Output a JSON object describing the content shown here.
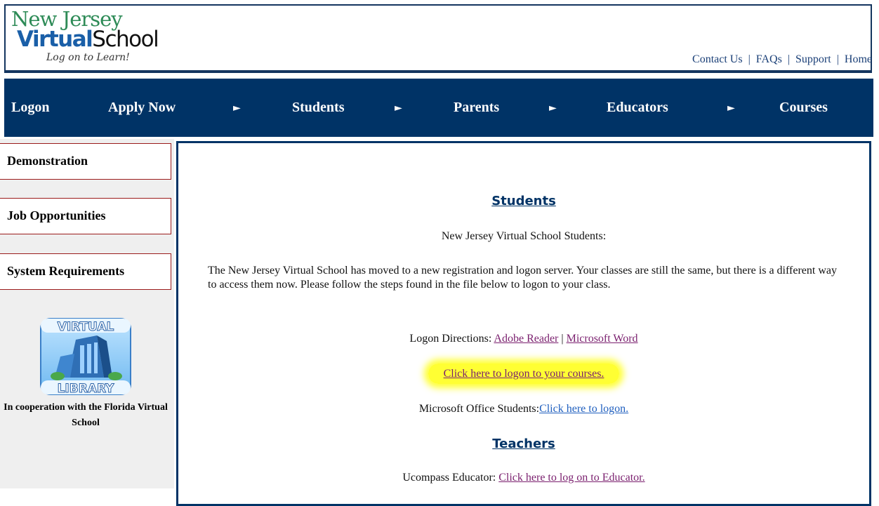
{
  "header": {
    "logo": {
      "line1": "New Jersey",
      "virtual": "Virtual",
      "school": "School",
      "tagline": "Log on to Learn!"
    },
    "top_links": [
      "Contact Us",
      "FAQs",
      "Support",
      "Home"
    ],
    "separator": "|"
  },
  "nav": {
    "items": [
      "Logon",
      "Apply Now",
      "Students",
      "Parents",
      "Educators",
      "Courses"
    ],
    "arrow": "►"
  },
  "sidebar": {
    "items": [
      "Demonstration",
      "Job Opportunities",
      "System Requirements"
    ],
    "virtual_library": {
      "top": "VIRTUAL",
      "bottom": "LIBRARY",
      "caption": "In cooperation with the Florida Virtual School"
    }
  },
  "content": {
    "students_heading": "Students",
    "students_intro": "New Jersey Virtual School Students:",
    "paragraph": "The New Jersey Virtual School has moved to a new registration and logon server. Your classes are still the same, but there is a different way to access them now. Please follow the steps found in the file below to logon to your class.",
    "logon_directions_label": "Logon Directions:",
    "adobe_link": "Adobe Reader",
    "word_link": "Microsoft Word",
    "logon_courses_link": "Click here to logon to your courses.",
    "ms_office_label": "Microsoft Office Students:",
    "ms_office_link": "Click here to logon.",
    "teachers_heading": "Teachers",
    "ucompass_label": "Ucompass Educator:",
    "ucompass_link": "Click here to log on to Educator."
  },
  "colors": {
    "navy": "#003366",
    "highlight": "#ffff33",
    "sidebar_border": "#9b1b1b",
    "link_visited": "#7a1f6e",
    "link": "#1f5fbf"
  }
}
